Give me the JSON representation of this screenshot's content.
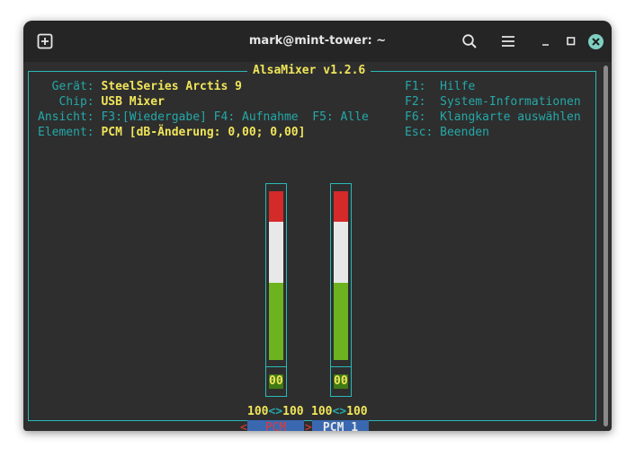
{
  "window": {
    "title": "mark@mint-tower: ~"
  },
  "icons": {
    "new_tab": "new-tab-icon",
    "search": "search-icon",
    "menu": "hamburger-menu-icon",
    "minimize": "minimize-icon",
    "maximize": "maximize-icon",
    "close": "close-icon"
  },
  "alsamixer": {
    "title": " AlsaMixer v1.2.6 ",
    "info": [
      {
        "label": "  Gerät:",
        "value": "SteelSeries Arctis 9"
      },
      {
        "label": "   Chip:",
        "value": "USB Mixer"
      },
      {
        "label": "Ansicht:",
        "value": "F3:[Wiedergabe] F4: Aufnahme  F5: Alle"
      },
      {
        "label": "Element:",
        "value": "PCM [dB-Änderung: 0,00; 0,00]"
      }
    ],
    "help": [
      {
        "key": "F1:",
        "action": "Hilfe"
      },
      {
        "key": "F2:",
        "action": "System-Informationen"
      },
      {
        "key": "F6:",
        "action": "Klangkarte auswählen"
      },
      {
        "key": "Esc:",
        "action": "Beenden"
      }
    ],
    "channels": [
      {
        "name": "PCM",
        "level_percent": 100,
        "mute_label": "00",
        "selected": true
      },
      {
        "name": "PCM 1",
        "level_percent": 100,
        "mute_label": "00",
        "selected": false
      }
    ],
    "volume_left": "100",
    "volume_right": "100",
    "volume_sep": "<>",
    "selector_left": "<",
    "selector_right": ">"
  },
  "colors": {
    "meter_red": "#d42a2a",
    "meter_white": "#e8e8e8",
    "meter_green": "#6db31f",
    "accent_cyan": "#2bb8b8",
    "label_yellow": "#f0e55a",
    "selected_red": "#e03b3b",
    "channel_blue": "#3a68b0"
  }
}
